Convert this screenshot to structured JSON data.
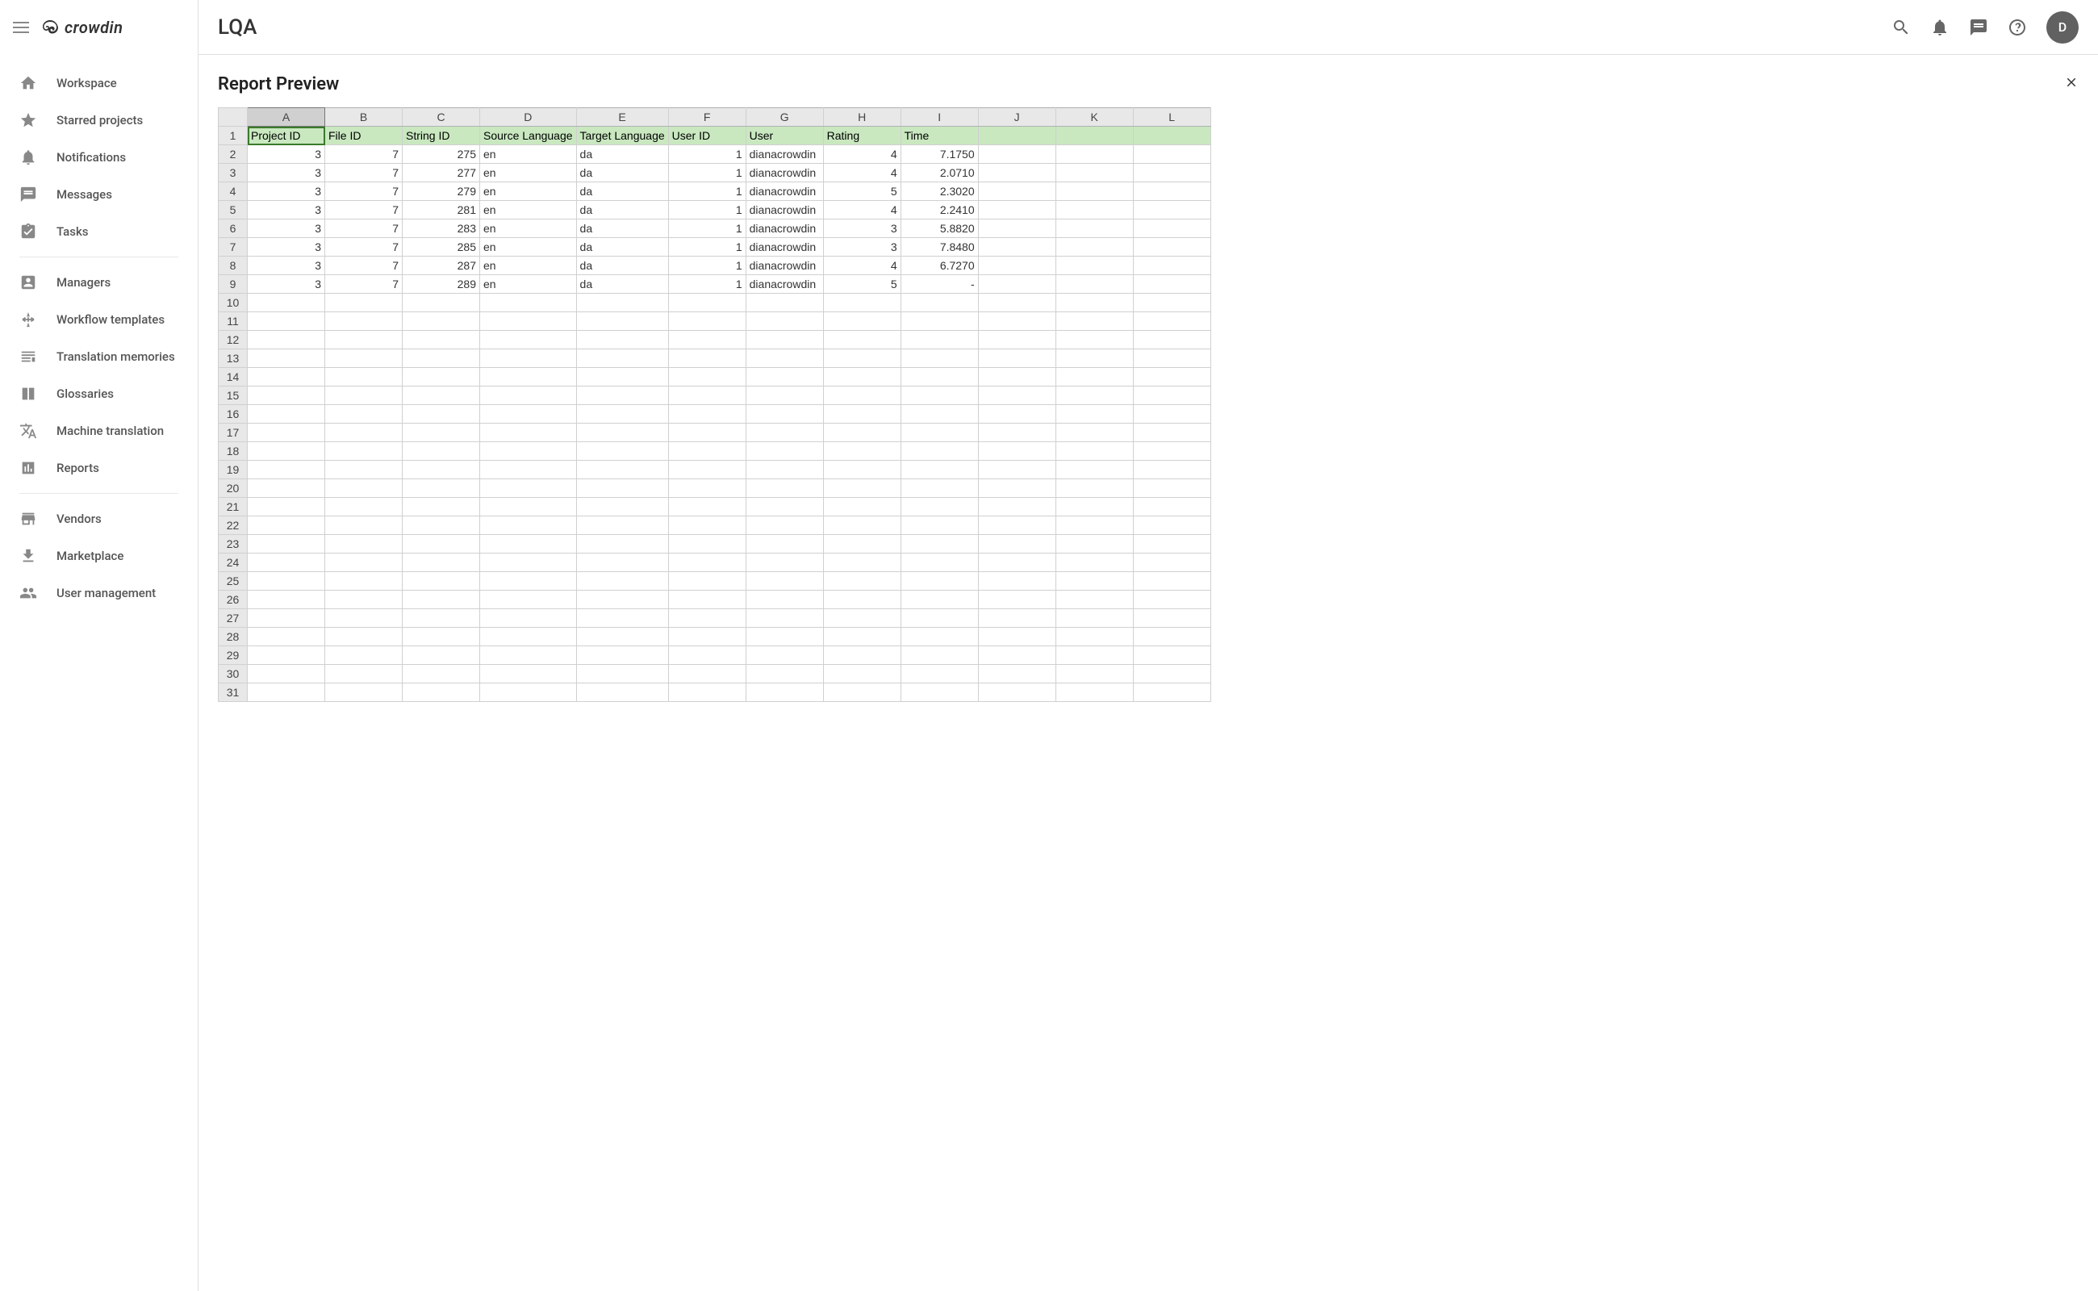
{
  "header": {
    "page_title": "LQA",
    "avatar_initial": "D"
  },
  "sidebar": {
    "logo_text": "crowdin",
    "groups": [
      {
        "items": [
          {
            "icon": "home",
            "label": "Workspace"
          },
          {
            "icon": "star",
            "label": "Starred projects"
          },
          {
            "icon": "bell",
            "label": "Notifications"
          },
          {
            "icon": "message",
            "label": "Messages"
          },
          {
            "icon": "task",
            "label": "Tasks"
          }
        ]
      },
      {
        "items": [
          {
            "icon": "person",
            "label": "Managers"
          },
          {
            "icon": "workflow",
            "label": "Workflow templates"
          },
          {
            "icon": "tm",
            "label": "Translation memories"
          },
          {
            "icon": "glossary",
            "label": "Glossaries"
          },
          {
            "icon": "mt",
            "label": "Machine translation"
          },
          {
            "icon": "report",
            "label": "Reports"
          }
        ]
      },
      {
        "items": [
          {
            "icon": "vendor",
            "label": "Vendors"
          },
          {
            "icon": "download",
            "label": "Marketplace"
          },
          {
            "icon": "users",
            "label": "User management"
          }
        ]
      }
    ]
  },
  "report": {
    "title": "Report Preview",
    "selected_col_letter": "A",
    "col_letters": [
      "A",
      "B",
      "C",
      "D",
      "E",
      "F",
      "G",
      "H",
      "I",
      "J",
      "K",
      "L"
    ],
    "headers": [
      "Project ID",
      "File ID",
      "String ID",
      "Source Language",
      "Target Language",
      "User ID",
      "User",
      "Rating",
      "Time"
    ],
    "rows": [
      {
        "project_id": 3,
        "file_id": 7,
        "string_id": 275,
        "src": "en",
        "tgt": "da",
        "user_id": 1,
        "user": "dianacrowdin",
        "rating": 4,
        "time": "7.1750"
      },
      {
        "project_id": 3,
        "file_id": 7,
        "string_id": 277,
        "src": "en",
        "tgt": "da",
        "user_id": 1,
        "user": "dianacrowdin",
        "rating": 4,
        "time": "2.0710"
      },
      {
        "project_id": 3,
        "file_id": 7,
        "string_id": 279,
        "src": "en",
        "tgt": "da",
        "user_id": 1,
        "user": "dianacrowdin",
        "rating": 5,
        "time": "2.3020"
      },
      {
        "project_id": 3,
        "file_id": 7,
        "string_id": 281,
        "src": "en",
        "tgt": "da",
        "user_id": 1,
        "user": "dianacrowdin",
        "rating": 4,
        "time": "2.2410"
      },
      {
        "project_id": 3,
        "file_id": 7,
        "string_id": 283,
        "src": "en",
        "tgt": "da",
        "user_id": 1,
        "user": "dianacrowdin",
        "rating": 3,
        "time": "5.8820"
      },
      {
        "project_id": 3,
        "file_id": 7,
        "string_id": 285,
        "src": "en",
        "tgt": "da",
        "user_id": 1,
        "user": "dianacrowdin",
        "rating": 3,
        "time": "7.8480"
      },
      {
        "project_id": 3,
        "file_id": 7,
        "string_id": 287,
        "src": "en",
        "tgt": "da",
        "user_id": 1,
        "user": "dianacrowdin",
        "rating": 4,
        "time": "6.7270"
      },
      {
        "project_id": 3,
        "file_id": 7,
        "string_id": 289,
        "src": "en",
        "tgt": "da",
        "user_id": 1,
        "user": "dianacrowdin",
        "rating": 5,
        "time": "-"
      }
    ],
    "total_rows": 31
  }
}
